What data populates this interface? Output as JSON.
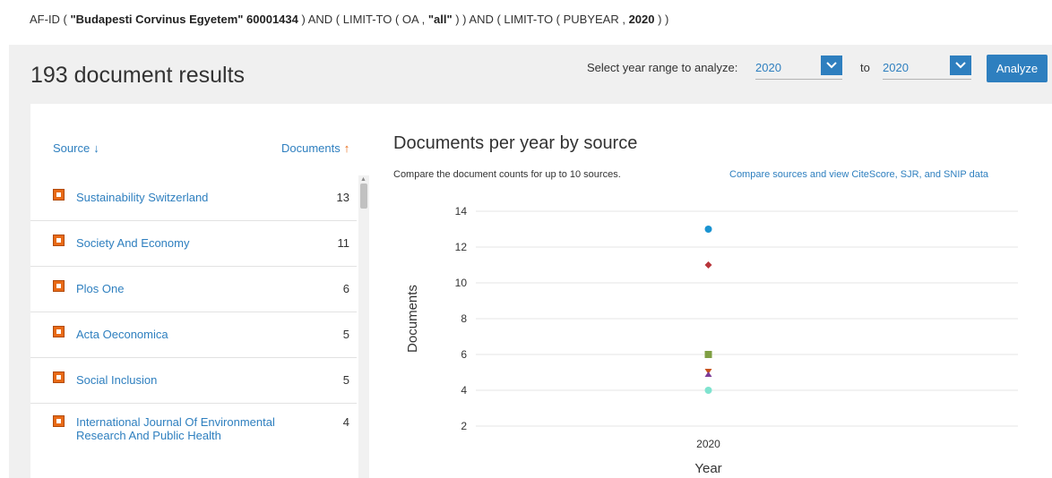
{
  "query": {
    "p1": "AF-ID ( ",
    "b1": "\"Budapesti Corvinus Egyetem\"  60001434",
    "p2": " ) AND  (  LIMIT-TO ( OA ,  ",
    "b2": "\"all\"",
    "p3": " ) )  AND  (  LIMIT-TO ( PUBYEAR ,  ",
    "b3": "2020",
    "p4": " ) )"
  },
  "header": {
    "results_title": "193 document results",
    "year_range_label": "Select year range to analyze:",
    "from_year": "2020",
    "to_label": "to",
    "to_year": "2020",
    "analyze_label": "Analyze"
  },
  "colors": {
    "accent": "#2e7fbf",
    "checkbox": "#e86a16",
    "sort_arrow": "#e86a16"
  },
  "list": {
    "source_header": "Source",
    "source_arrow": "↓",
    "documents_header": "Documents",
    "documents_arrow": "↑",
    "items": [
      {
        "name": "Sustainability Switzerland",
        "count": "13"
      },
      {
        "name": "Society And Economy",
        "count": "11"
      },
      {
        "name": "Plos One",
        "count": "6"
      },
      {
        "name": "Acta Oeconomica",
        "count": "5"
      },
      {
        "name": "Social Inclusion",
        "count": "5"
      },
      {
        "name": "International Journal Of Environmental Research And Public Health",
        "count": "4"
      }
    ]
  },
  "chart_title": "Documents per year by source",
  "chart_subtitle": "Compare the document counts for up to 10 sources.",
  "chart_link": "Compare sources and view CiteScore, SJR, and SNIP data",
  "chart_data": {
    "type": "scatter",
    "title": "",
    "xlabel": "Year",
    "ylabel": "Documents",
    "categories": [
      "2020"
    ],
    "ylim": [
      2,
      14
    ],
    "yticks": [
      2,
      4,
      6,
      8,
      10,
      12,
      14
    ],
    "grid": true,
    "series": [
      {
        "name": "Sustainability Switzerland",
        "values": [
          13
        ],
        "color": "#1a93d1",
        "marker": "circle"
      },
      {
        "name": "Society And Economy",
        "values": [
          11
        ],
        "color": "#b8353b",
        "marker": "diamond"
      },
      {
        "name": "Plos One",
        "values": [
          6
        ],
        "color": "#7f9f43",
        "marker": "square"
      },
      {
        "name": "Acta Oeconomica",
        "values": [
          5
        ],
        "color": "#c8531e",
        "marker": "triangle-down"
      },
      {
        "name": "Social Inclusion",
        "values": [
          5
        ],
        "color": "#7d3c98",
        "marker": "triangle"
      },
      {
        "name": "International Journal Of Environmental Research And Public Health",
        "values": [
          4
        ],
        "color": "#7fe3cf",
        "marker": "circle"
      }
    ]
  }
}
